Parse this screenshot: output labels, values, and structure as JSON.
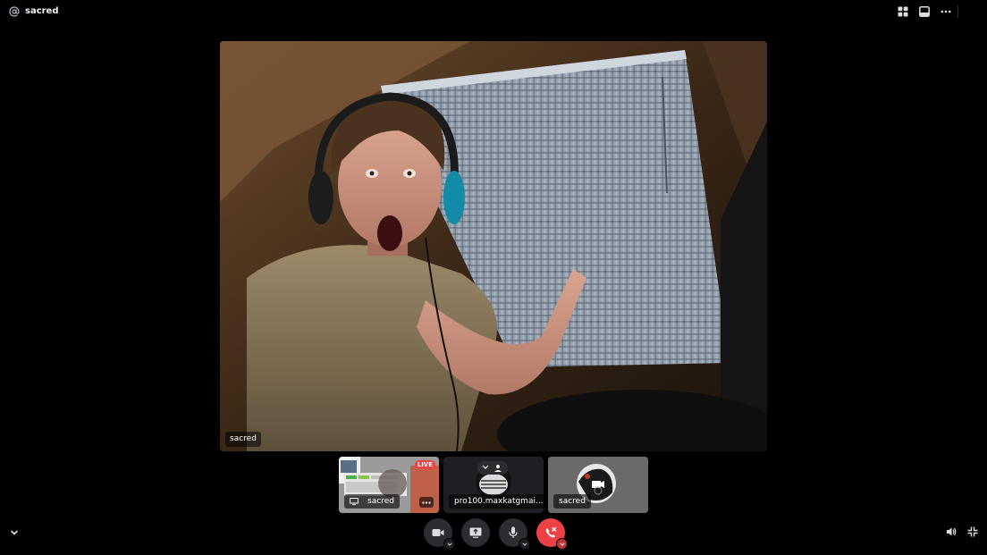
{
  "header": {
    "channel_name": "sacred"
  },
  "main_video": {
    "participant_name": "sacred"
  },
  "tiles": [
    {
      "label": "sacred",
      "badge": "LIVE",
      "type": "screen-share"
    },
    {
      "label": "pro100.maxkatgmai...",
      "type": "avatar"
    },
    {
      "label": "sacred",
      "type": "camera-off"
    }
  ],
  "colors": {
    "background": "#000000",
    "control_bg": "#2b2d31",
    "hangup_red": "#ed4245",
    "live_red": "#ed4245"
  },
  "icons": {
    "top_left": "at-sign-icon",
    "top_right": [
      "grid-icon",
      "inbox-icon",
      "more-icon"
    ],
    "controls": [
      "camera-icon",
      "screen-share-icon",
      "microphone-icon",
      "hangup-icon"
    ],
    "bottom_left": "chevron-down-icon",
    "bottom_right": [
      "volume-icon",
      "exit-fullscreen-icon"
    ]
  }
}
